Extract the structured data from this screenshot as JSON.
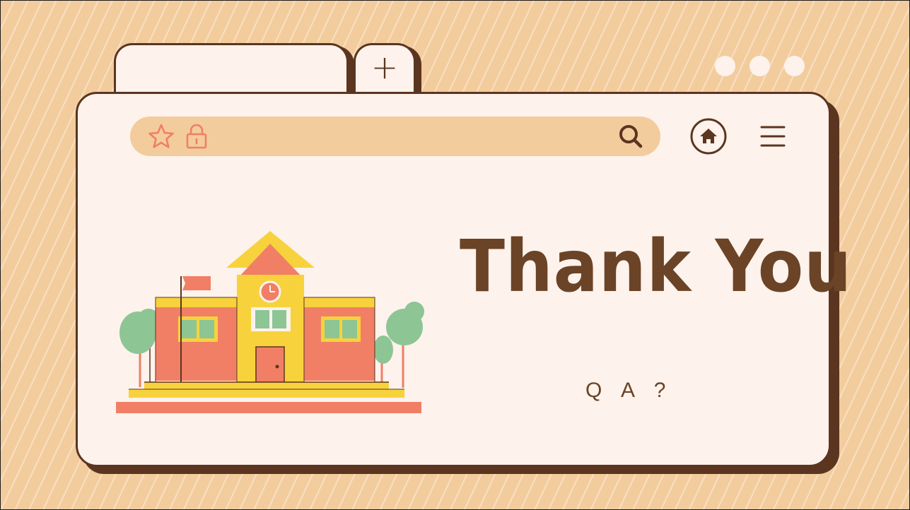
{
  "browser": {
    "tabs": [
      {
        "label": ""
      },
      {
        "label": "+"
      }
    ],
    "window_controls": 3
  },
  "toolbar": {
    "address_value": "",
    "icons": [
      "star-icon",
      "lock-icon",
      "search-icon",
      "home-icon",
      "menu-icon"
    ]
  },
  "content": {
    "title": "Thank You",
    "subtitle": "Q A ?"
  },
  "colors": {
    "background": "#f3cc9d",
    "window": "#fdf2ec",
    "outline": "#5b3520",
    "text": "#6b4326",
    "accent": "#f07f66"
  }
}
